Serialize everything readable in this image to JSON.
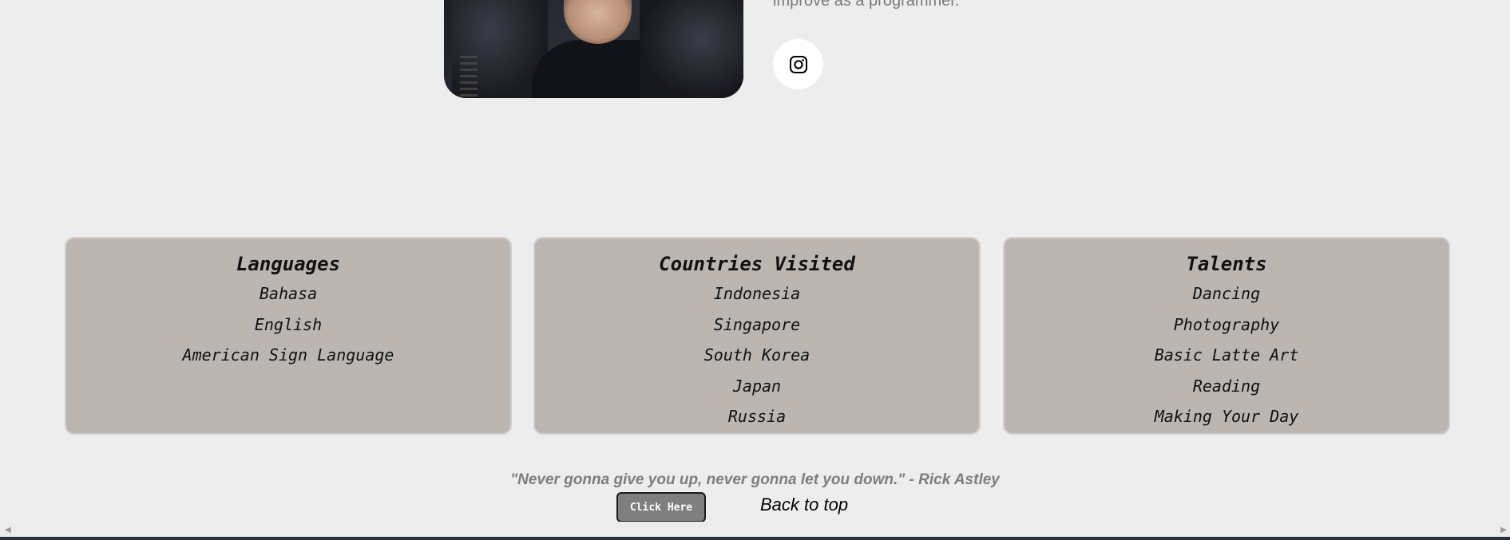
{
  "profile": {
    "bio_tail": "improve as a programmer.",
    "social_icon": "instagram-icon"
  },
  "cards": [
    {
      "title": "Languages",
      "items": [
        "Bahasa",
        "English",
        "American Sign Language"
      ]
    },
    {
      "title": "Countries Visited",
      "items": [
        "Indonesia",
        "Singapore",
        "South Korea",
        "Japan",
        "Russia"
      ]
    },
    {
      "title": "Talents",
      "items": [
        "Dancing",
        "Photography",
        "Basic Latte Art",
        "Reading",
        "Making Your Day"
      ]
    }
  ],
  "footer": {
    "quote": "\"Never gonna give you up, never gonna let you down.\" - Rick Astley",
    "button_label": "Click Here",
    "back_to_top": "Back to top"
  },
  "colors": {
    "background": "#ededed",
    "card": "#bcb6b2",
    "button": "#7f7f7f"
  }
}
